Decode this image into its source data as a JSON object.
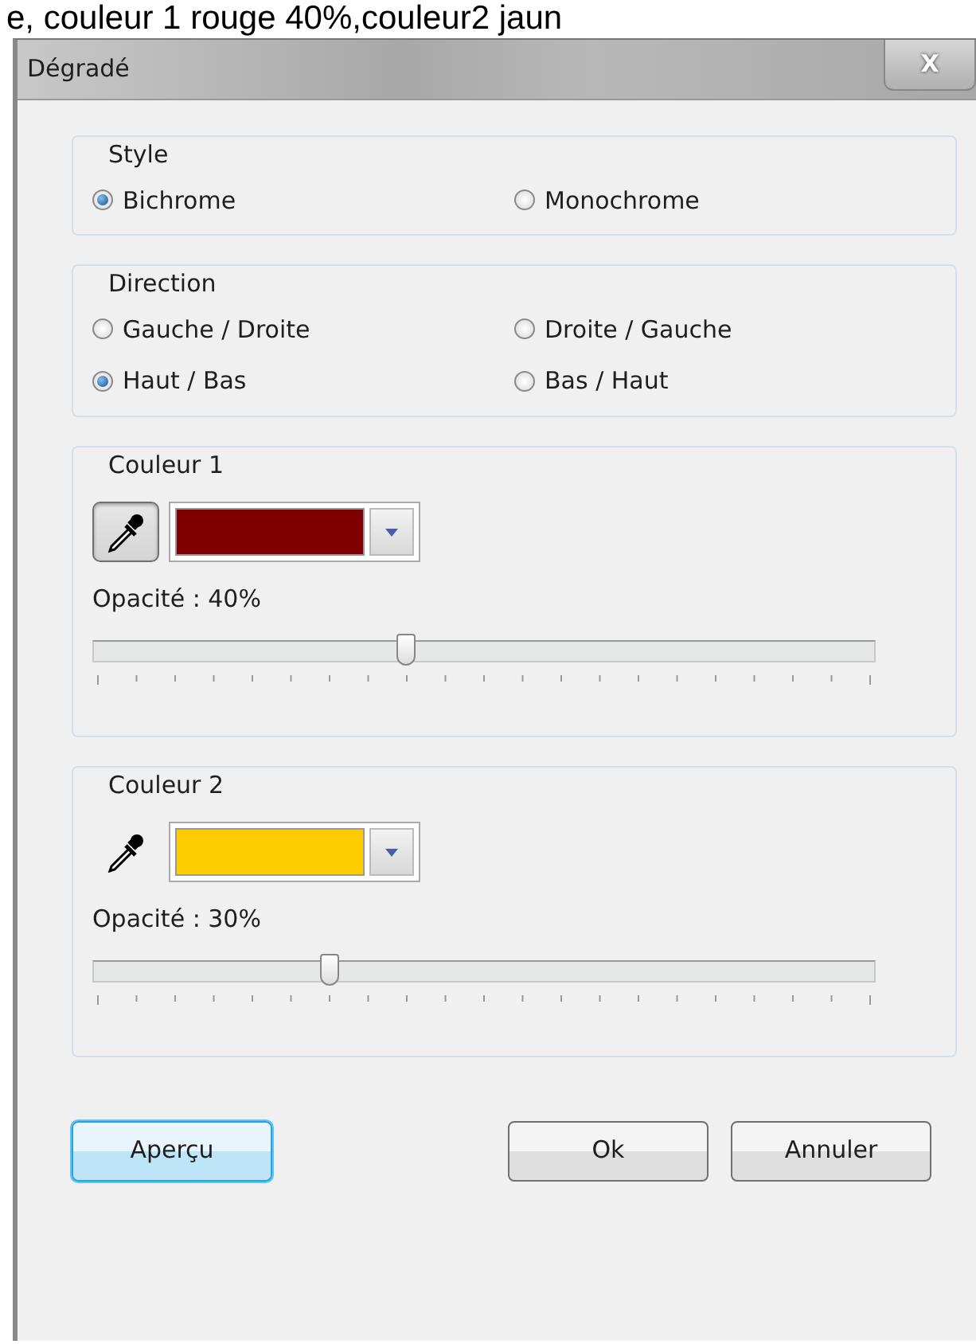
{
  "caption": "e, couleur 1 rouge 40%,couleur2 jaun",
  "window": {
    "title": "Dégradé",
    "close": "X"
  },
  "style_group": {
    "title": "Style",
    "options": [
      {
        "label": "Bichrome",
        "selected": true
      },
      {
        "label": "Monochrome",
        "selected": false
      }
    ]
  },
  "direction_group": {
    "title": "Direction",
    "options": [
      {
        "label": "Gauche / Droite",
        "selected": false
      },
      {
        "label": "Droite / Gauche",
        "selected": false
      },
      {
        "label": "Haut / Bas",
        "selected": true
      },
      {
        "label": "Bas / Haut",
        "selected": false
      }
    ]
  },
  "colors": [
    {
      "title": "Couleur 1",
      "picker_active": true,
      "color": "#7f0000",
      "opacity_label": "Opacité : 40%",
      "level": 0.4
    },
    {
      "title": "Couleur 2",
      "picker_active": false,
      "color": "#ffcc00",
      "opacity_label": "Opacité : 30%",
      "level": 0.3
    }
  ],
  "buttons": [
    {
      "label": "Aperçu",
      "default": true
    },
    {
      "label": "Ok",
      "default": false
    },
    {
      "label": "Annuler",
      "default": false
    }
  ]
}
